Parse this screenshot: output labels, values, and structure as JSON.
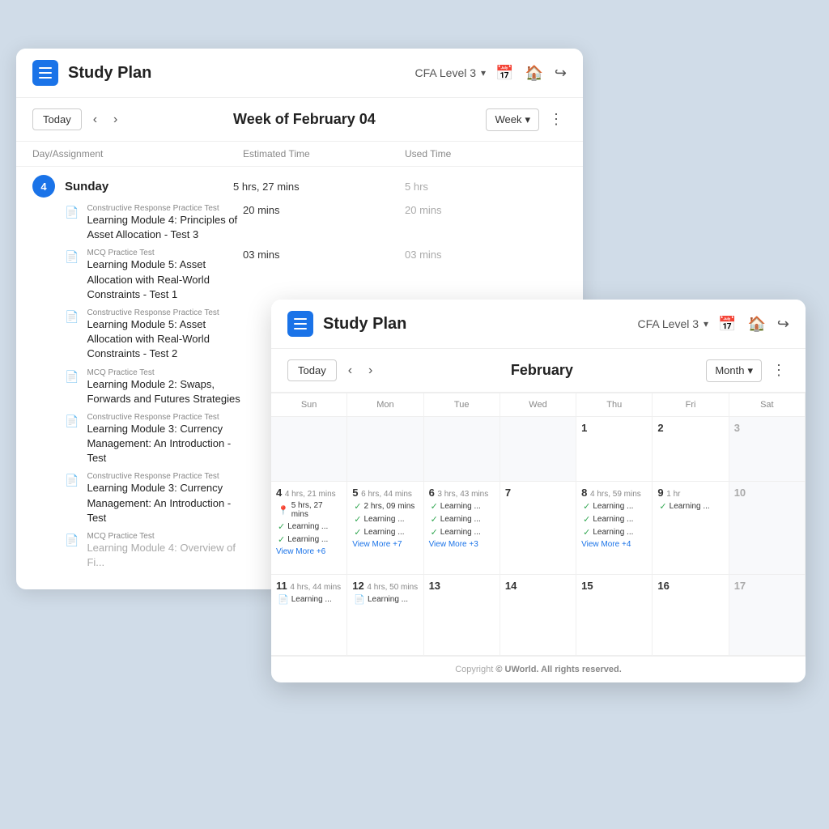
{
  "back_card": {
    "title": "Study Plan",
    "level": "CFA Level 3",
    "toolbar": {
      "today_label": "Today",
      "period": "Week of February 04",
      "view": "Week"
    },
    "columns": {
      "day": "Day/Assignment",
      "estimated": "Estimated Time",
      "used": "Used Time"
    },
    "days": [
      {
        "num": "4",
        "name": "Sunday",
        "estimated": "5 hrs, 27 mins",
        "used": "5 hrs",
        "assignments": [
          {
            "type": "Constructive Response Practice Test",
            "name": "Learning Module 4: Principles of Asset Allocation - Test 3",
            "estimated": "20 mins",
            "used": "20 mins"
          },
          {
            "type": "MCQ Practice Test",
            "name": "Learning Module 5: Asset Allocation with Real-World Constraints - Test 1",
            "estimated": "03 mins",
            "used": "03 mins"
          },
          {
            "type": "Constructive Response Practice Test",
            "name": "Learning Module 5: Asset Allocation with Real-World Constraints - Test 2",
            "estimated": "",
            "used": ""
          },
          {
            "type": "MCQ Practice Test",
            "name": "Learning Module 2: Swaps, Forwards and Futures Strategies",
            "estimated": "",
            "used": ""
          },
          {
            "type": "Constructive Response Practice Test",
            "name": "Learning Module 3: Currency Management: An Introduction - Test",
            "estimated": "",
            "used": ""
          },
          {
            "type": "Constructive Response Practice Test",
            "name": "Learning Module 3: Currency Management: An Introduction - Test",
            "estimated": "",
            "used": ""
          },
          {
            "type": "MCQ Practice Test",
            "name": "Learning Module 4: Overview of Fi...",
            "estimated": "",
            "used": ""
          }
        ]
      }
    ]
  },
  "front_card": {
    "title": "Study Plan",
    "level": "CFA Level 3",
    "toolbar": {
      "today_label": "Today",
      "period": "February",
      "view": "Month"
    },
    "weekdays": [
      "Sun",
      "Mon",
      "Tue",
      "Wed",
      "Thu",
      "Fri",
      "Sat"
    ],
    "weeks": [
      {
        "cells": [
          {
            "day": "",
            "other": true,
            "time": "",
            "events": [],
            "more": ""
          },
          {
            "day": "",
            "other": true,
            "time": "",
            "events": [],
            "more": ""
          },
          {
            "day": "",
            "other": true,
            "time": "",
            "events": [],
            "more": ""
          },
          {
            "day": "",
            "other": true,
            "time": "",
            "events": [],
            "more": ""
          },
          {
            "day": "1",
            "other": false,
            "time": "",
            "events": [],
            "more": ""
          },
          {
            "day": "2",
            "other": false,
            "time": "",
            "events": [],
            "more": ""
          },
          {
            "day": "3",
            "other": false,
            "time": "",
            "events": [],
            "more": ""
          }
        ]
      },
      {
        "cells": [
          {
            "day": "4",
            "other": false,
            "time": "4 hrs, 21 mins",
            "events": [
              {
                "icon": "pin",
                "label": "5 hrs, 27 mins"
              },
              {
                "icon": "check",
                "label": "Learning ..."
              },
              {
                "icon": "check",
                "label": "Learning ..."
              }
            ],
            "more": "View More +6"
          },
          {
            "day": "5",
            "other": false,
            "time": "6 hrs, 44 mins",
            "events": [
              {
                "icon": "check",
                "label": "2 hrs, 09 mins"
              },
              {
                "icon": "check",
                "label": "Learning ..."
              },
              {
                "icon": "check",
                "label": "Learning ..."
              }
            ],
            "more": "View More +7"
          },
          {
            "day": "6",
            "other": false,
            "time": "3 hrs, 43 mins",
            "events": [
              {
                "icon": "check",
                "label": "Learning ..."
              },
              {
                "icon": "check",
                "label": "Learning ..."
              },
              {
                "icon": "check",
                "label": "Learning ..."
              }
            ],
            "more": "View More +3"
          },
          {
            "day": "7",
            "other": false,
            "time": "",
            "events": [],
            "more": ""
          },
          {
            "day": "8",
            "other": false,
            "time": "4 hrs, 59 mins",
            "events": [
              {
                "icon": "check",
                "label": "Learning ..."
              },
              {
                "icon": "check",
                "label": "Learning ..."
              },
              {
                "icon": "check",
                "label": "Learning ..."
              }
            ],
            "more": "View More +4"
          },
          {
            "day": "9",
            "other": false,
            "time": "1 hr",
            "events": [
              {
                "icon": "check",
                "label": "Learning ..."
              }
            ],
            "more": ""
          },
          {
            "day": "10",
            "other": false,
            "time": "",
            "events": [],
            "more": ""
          }
        ]
      },
      {
        "cells": [
          {
            "day": "11",
            "other": false,
            "time": "4 hrs, 44 mins",
            "events": [
              {
                "icon": "doc",
                "label": "Learning ..."
              }
            ],
            "more": ""
          },
          {
            "day": "12",
            "other": false,
            "time": "4 hrs, 50 mins",
            "events": [
              {
                "icon": "doc",
                "label": "Learning ..."
              }
            ],
            "more": ""
          },
          {
            "day": "13",
            "other": false,
            "time": "",
            "events": [],
            "more": ""
          },
          {
            "day": "14",
            "other": false,
            "time": "",
            "events": [],
            "more": ""
          },
          {
            "day": "15",
            "other": false,
            "time": "",
            "events": [],
            "more": ""
          },
          {
            "day": "16",
            "other": false,
            "time": "",
            "events": [],
            "more": ""
          },
          {
            "day": "17",
            "other": false,
            "time": "",
            "events": [],
            "more": ""
          }
        ]
      }
    ],
    "copyright": "Copyright",
    "copyright_entity": "© UWorld. All rights reserved."
  }
}
